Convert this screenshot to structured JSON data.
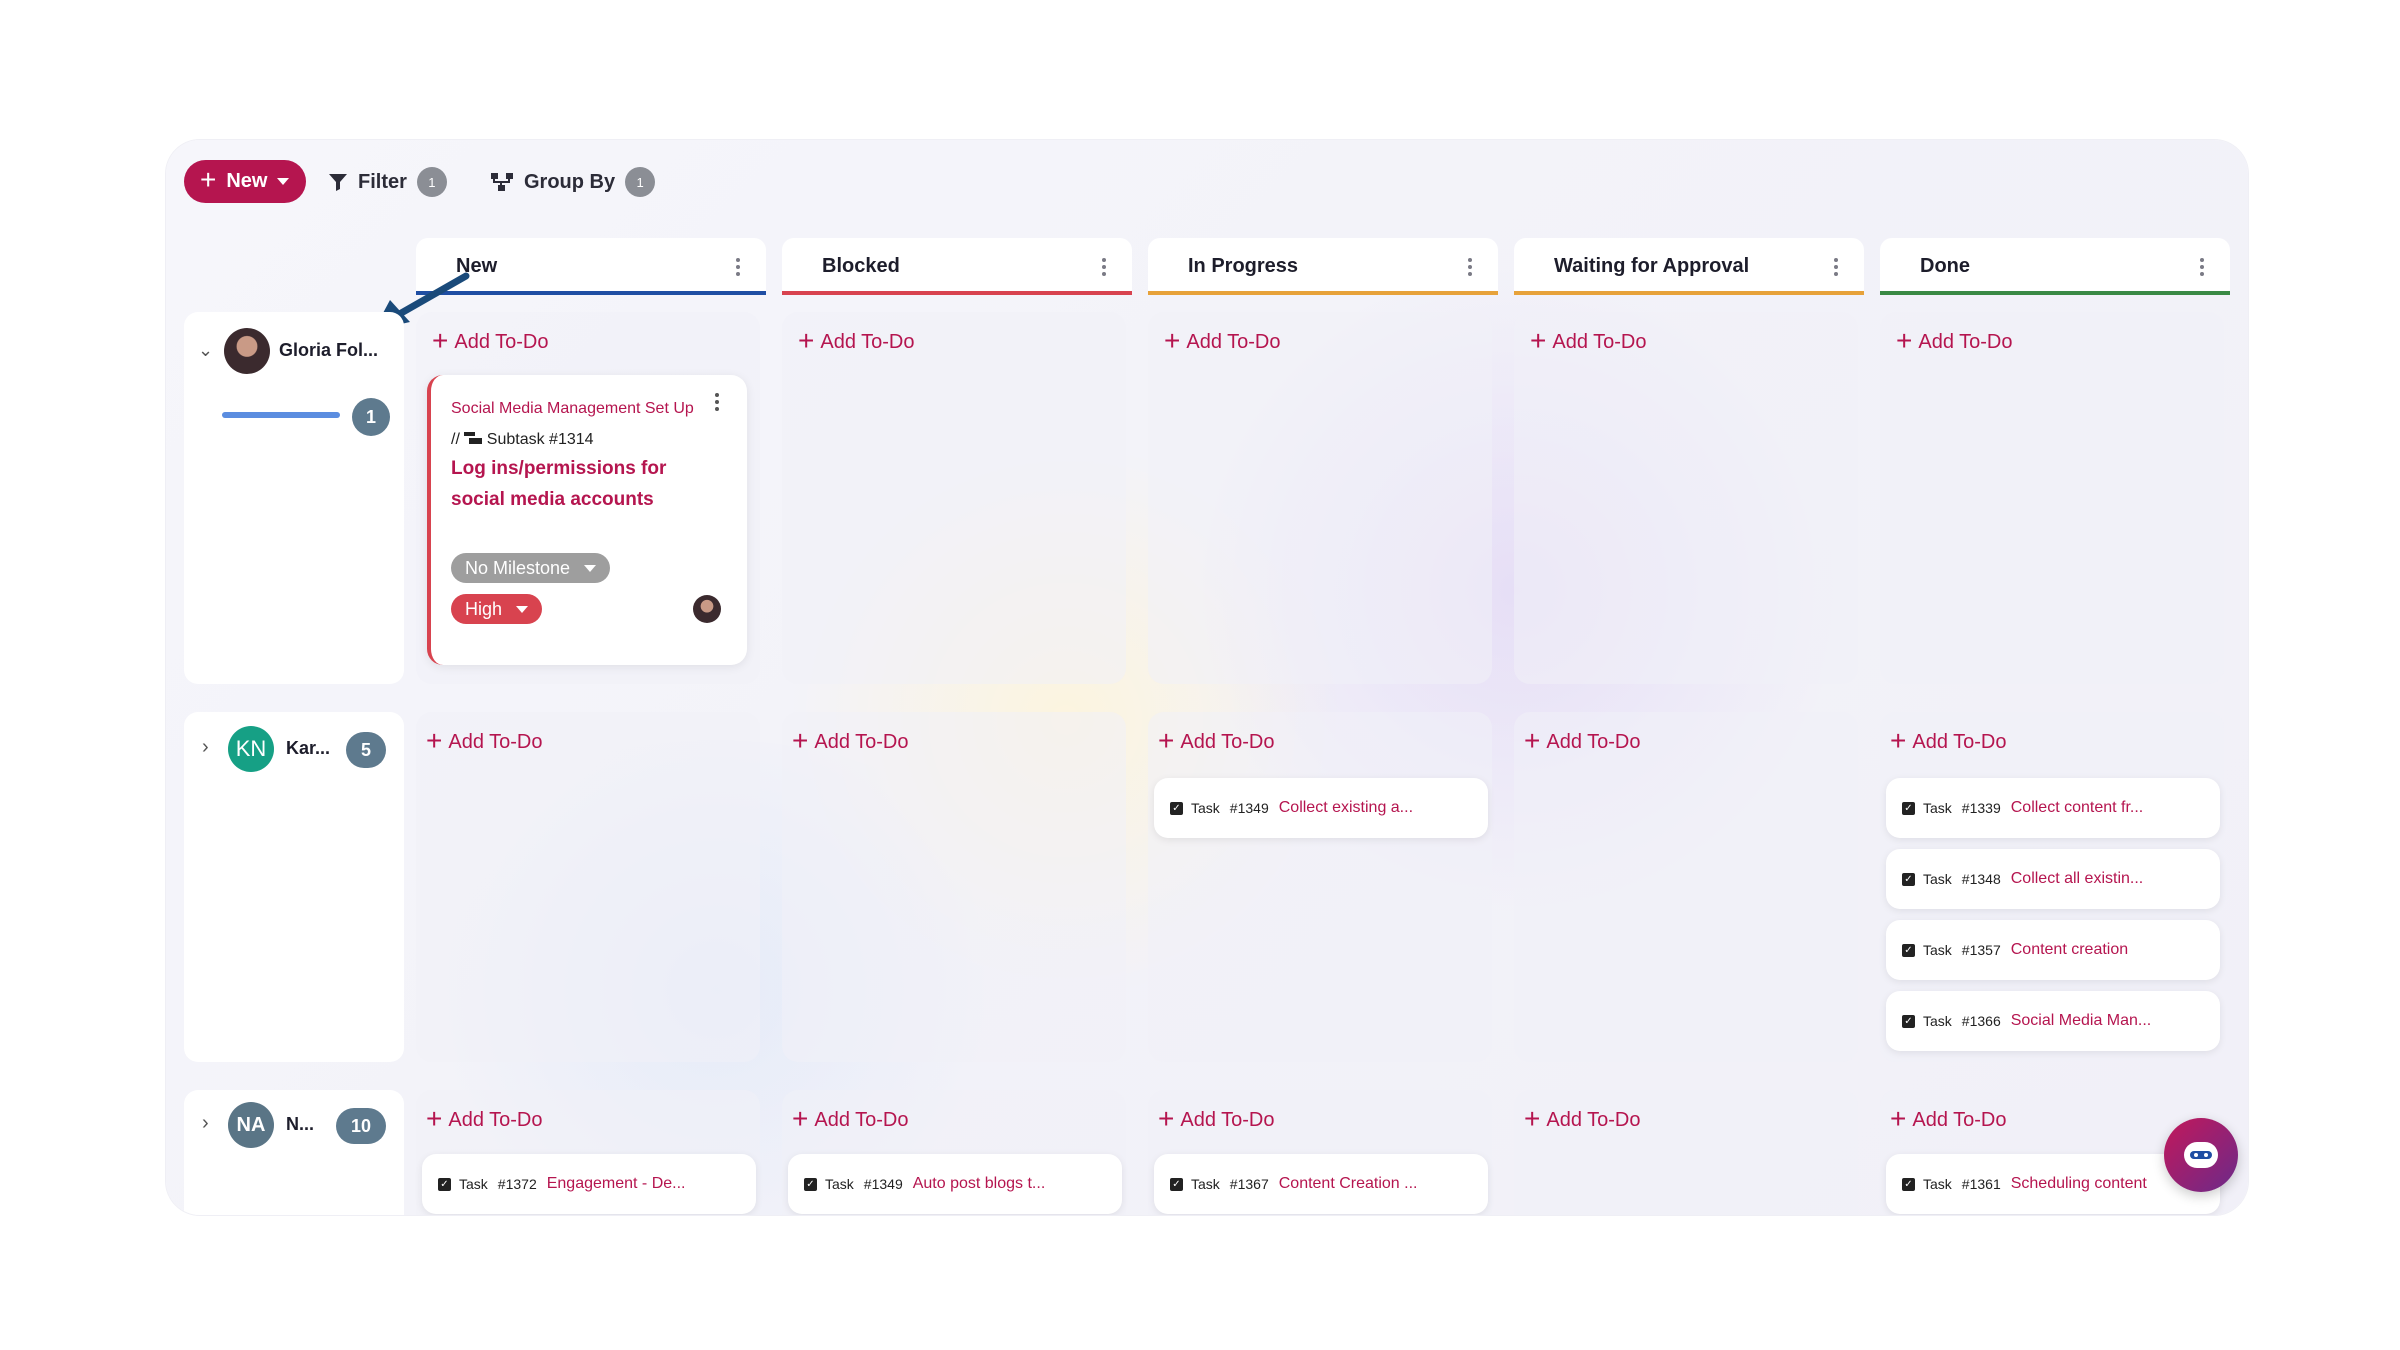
{
  "toolbar": {
    "new_label": "New",
    "filter_label": "Filter",
    "filter_count": "1",
    "groupby_label": "Group By",
    "groupby_count": "1"
  },
  "columns": [
    {
      "label": "New",
      "color": "#1f4ea3"
    },
    {
      "label": "Blocked",
      "color": "#d8434f"
    },
    {
      "label": "In Progress",
      "color": "#e7a23a"
    },
    {
      "label": "Waiting for Approval",
      "color": "#e7a23a"
    },
    {
      "label": "Done",
      "color": "#3a8a45"
    }
  ],
  "add_todo": "Add To-Do",
  "rows": [
    {
      "name": "Gloria Fol...",
      "count": "1",
      "progress": 1.0
    },
    {
      "name": "Kar...",
      "initials": "KN",
      "count": "5",
      "avatar_color": "#16a085"
    },
    {
      "name": "N...",
      "initials": "NA",
      "count": "10",
      "avatar_color": "#5a7586"
    }
  ],
  "featured_card": {
    "parent": "Social Media Management Set Up",
    "separator": "//",
    "subtask": "Subtask #1314",
    "title": "Log ins/permissions for social media accounts",
    "milestone": "No Milestone",
    "priority": "High"
  },
  "task_word": "Task",
  "tasks": {
    "row2_inprogress": [
      {
        "id": "#1349",
        "title": "Collect existing a..."
      }
    ],
    "row2_done": [
      {
        "id": "#1339",
        "title": "Collect content fr..."
      },
      {
        "id": "#1348",
        "title": "Collect all existin..."
      },
      {
        "id": "#1357",
        "title": "Content creation"
      },
      {
        "id": "#1366",
        "title": "Social Media Man..."
      }
    ],
    "row3_new": [
      {
        "id": "#1372",
        "title": "Engagement - De..."
      }
    ],
    "row3_blocked": [
      {
        "id": "#1349",
        "title": "Auto post blogs t..."
      }
    ],
    "row3_inprogress": [
      {
        "id": "#1367",
        "title": "Content Creation ..."
      }
    ],
    "row3_done": [
      {
        "id": "#1361",
        "title": "Scheduling content"
      }
    ]
  },
  "colors": {
    "accent": "#b5154f",
    "badge": "#5e7a8e",
    "high": "#d8434f",
    "milestone": "#9e9e9e"
  }
}
